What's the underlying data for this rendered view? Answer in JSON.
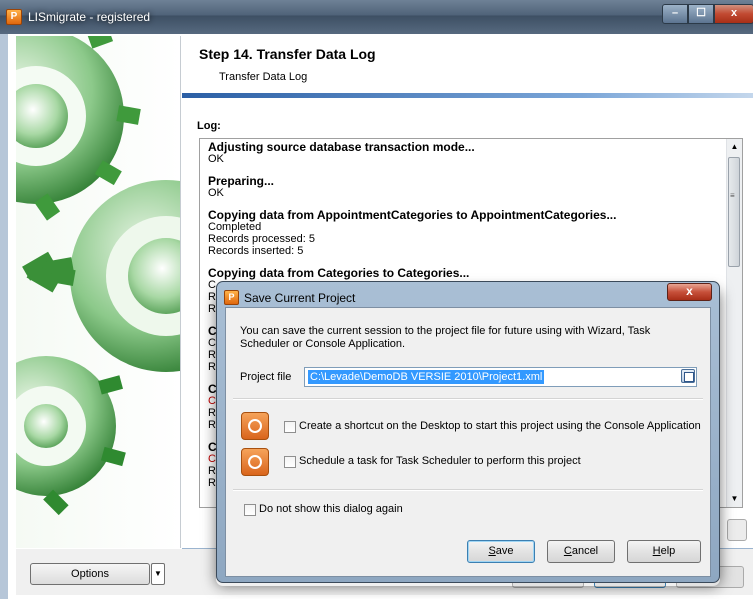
{
  "window": {
    "title": "LISmigrate - registered",
    "minimize": "–",
    "maximize": "☐",
    "close": "x",
    "app_icon_glyph": "P"
  },
  "wizard": {
    "step_title": "Step 14. Transfer Data Log",
    "step_subtitle": "Transfer Data Log",
    "log_label": "Log:"
  },
  "log": [
    {
      "heading": "Adjusting source database transaction mode...",
      "lines": [
        {
          "text": "OK"
        }
      ]
    },
    {
      "heading": "Preparing...",
      "lines": [
        {
          "text": "OK"
        }
      ]
    },
    {
      "heading": "Copying data from AppointmentCategories to AppointmentCategories...",
      "lines": [
        {
          "text": "Completed"
        },
        {
          "text": "Records processed: 5"
        },
        {
          "text": "Records inserted: 5"
        }
      ]
    },
    {
      "heading": "Copying data from Categories to Categories...",
      "lines": [
        {
          "text": "C"
        },
        {
          "text": "R"
        },
        {
          "text": "R"
        }
      ]
    },
    {
      "heading": "C",
      "lines": [
        {
          "text": "C"
        },
        {
          "text": "R"
        },
        {
          "text": "R"
        }
      ]
    },
    {
      "heading": "C",
      "lines": [
        {
          "text": "C",
          "error": true
        },
        {
          "text": "R"
        },
        {
          "text": "R"
        }
      ]
    },
    {
      "heading": "C",
      "lines": [
        {
          "text": "C",
          "error": true
        },
        {
          "text": "R"
        },
        {
          "text": "R"
        }
      ]
    }
  ],
  "bottom": {
    "options_label": "Options",
    "options_dropdown_glyph": "▼"
  },
  "dialog": {
    "title": "Save Current Project",
    "close": "x",
    "description": "You can save the current session to the project file for future using with Wizard, Task Scheduler or Console Application.",
    "project_file_label": "Project file",
    "project_file_value": "C:\\Levade\\DemoDB VERSIE 2010\\Project1.xml",
    "shortcut_label": "Create a shortcut on the Desktop to start this project using the Console Application",
    "schedule_label": "Schedule a task for Task Scheduler to perform this project",
    "noshow_label": "Do not show this dialog again",
    "save_first": "S",
    "save_rest": "ave",
    "cancel_first": "C",
    "cancel_rest": "ancel",
    "help_first": "H",
    "help_rest": "elp",
    "icon_glyph": "P"
  },
  "colors": {
    "gear_green": "#3f9a3c",
    "selection_blue": "#3399ff",
    "error_red": "#c00000",
    "header_band": "#2b5fa5"
  },
  "icons": {
    "app": "app-logo-icon",
    "browse": "floppy-disk-icon",
    "shortcut": "shortcut-gear-icon",
    "schedule": "schedule-clock-icon"
  }
}
